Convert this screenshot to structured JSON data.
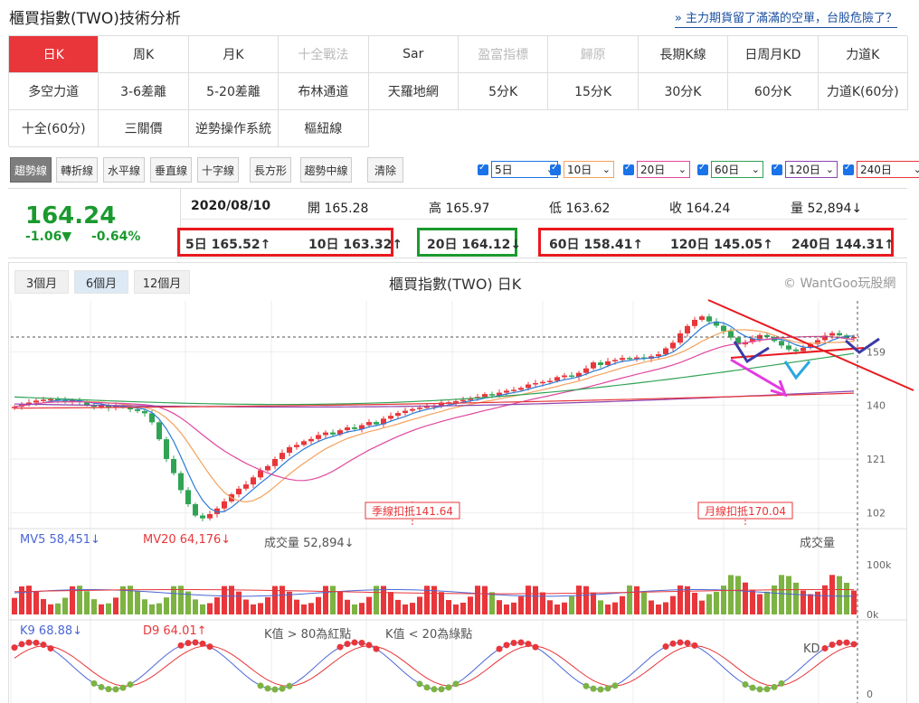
{
  "header": {
    "title": "櫃買指數(TWO)技術分析",
    "link": "» 主力期貨留了滿滿的空單，台股危險了？"
  },
  "grid": [
    {
      "label": "日K",
      "state": "active"
    },
    {
      "label": "周K"
    },
    {
      "label": "月K"
    },
    {
      "label": "十全戰法",
      "state": "disabled"
    },
    {
      "label": "Sar"
    },
    {
      "label": "盈富指標",
      "state": "disabled"
    },
    {
      "label": "歸原",
      "state": "disabled"
    },
    {
      "label": "長期K線"
    },
    {
      "label": "日周月KD"
    },
    {
      "label": "力道K"
    },
    {
      "label": "多空力道"
    },
    {
      "label": "3-6差離"
    },
    {
      "label": "5-20差離"
    },
    {
      "label": "布林通道"
    },
    {
      "label": "天羅地網"
    },
    {
      "label": "5分K"
    },
    {
      "label": "15分K"
    },
    {
      "label": "30分K"
    },
    {
      "label": "60分K"
    },
    {
      "label": "力道K(60分)"
    },
    {
      "label": "十全(60分)"
    },
    {
      "label": "三關價"
    },
    {
      "label": "逆勢操作系統"
    },
    {
      "label": "樞紐線"
    }
  ],
  "tools": [
    "趨勢線",
    "轉折線",
    "水平線",
    "垂直線",
    "十字線",
    "長方形",
    "趨勢中線",
    "清除"
  ],
  "ma_selectors": [
    {
      "label": "5日",
      "color": "#1a73e8"
    },
    {
      "label": "10日",
      "color": "#f5a25d"
    },
    {
      "label": "20日",
      "color": "#e0479e"
    },
    {
      "label": "60日",
      "color": "#31a354"
    },
    {
      "label": "120日",
      "color": "#8e44ad"
    },
    {
      "label": "240日",
      "color": "#e8363a"
    }
  ],
  "quote": {
    "price": "164.24",
    "change": "-1.06▼",
    "change_pct": "-0.64%",
    "date": "2020/08/10",
    "open": "開 165.28",
    "high": "高 165.97",
    "low": "低 163.62",
    "close": "收 164.24",
    "volume": "量 52,894↓"
  },
  "ma_values": [
    {
      "label": "5日 165.52↑",
      "color": "#2a7bd6"
    },
    {
      "label": "10日 163.32↑",
      "color": "#f0a060"
    },
    {
      "label": "20日 164.12↓",
      "color": "#e0479e"
    },
    {
      "label": "60日 158.41↑",
      "color": "#31a354"
    },
    {
      "label": "120日 145.05↑",
      "color": "#8e44ad"
    },
    {
      "label": "240日 144.31↑",
      "color": "#e8363a"
    }
  ],
  "ranges": [
    "3個月",
    "6個月",
    "12個月"
  ],
  "chart_title": "櫃買指數(TWO) 日K",
  "watermark": "© WantGoo玩股網",
  "annotations": {
    "quarter_line": "季線扣抵141.64",
    "month_line": "月線扣抵170.04"
  },
  "volume_panel": {
    "mv5": "MV5 58,451↓",
    "mv20": "MV20 64,176↓",
    "volume": "成交量 52,894↓",
    "label": "成交量"
  },
  "kd_panel": {
    "k": "K9 68.88↓",
    "d": "D9 64.01↑",
    "rule_red": "K值 > 80為紅點",
    "rule_green": "K值 < 20為綠點",
    "label": "KD"
  },
  "chart_data": [
    {
      "type": "candlestick",
      "title": "櫃買指數(TWO) 日K",
      "yticks": [
        102,
        121,
        140,
        159
      ],
      "ylim": [
        97,
        177
      ],
      "up_color": "#e8363a",
      "down_color": "#31a354",
      "closes": [
        139.5,
        140.3,
        141,
        141.7,
        142,
        142.2,
        141.8,
        141.4,
        141.7,
        141.1,
        140.2,
        139.5,
        139.9,
        139.1,
        140,
        139.4,
        138.6,
        138,
        137.2,
        134,
        128,
        121,
        116,
        110,
        105,
        101,
        100,
        101.5,
        103.5,
        106,
        108.5,
        110.5,
        112,
        114.5,
        117,
        118.5,
        121,
        123.2,
        125.2,
        126,
        127.3,
        128.1,
        129.5,
        130.4,
        129.7,
        131.2,
        132.2,
        131.6,
        133,
        134.1,
        133.3,
        135.3,
        136.3,
        137.3,
        138.1,
        138.7,
        139.2,
        139.6,
        139.9,
        141,
        141.1,
        141.5,
        141.9,
        142.5,
        143,
        144,
        143.5,
        144.5,
        145.2,
        145.5,
        146.2,
        147.4,
        147.9,
        148.3,
        148.7,
        150,
        150.6,
        150.1,
        151.5,
        153.1,
        155.2,
        154.3,
        155.6,
        156.1,
        156.8,
        156.5,
        157,
        156.5,
        157.4,
        158.1,
        160.2,
        162.2,
        165.5,
        168.1,
        170.3,
        171.5,
        169.7,
        168.2,
        166.3,
        164,
        161.6,
        162.4,
        163.6,
        164.9,
        164.2,
        162.8,
        161.2,
        159.8,
        159.2,
        160.4,
        161.7,
        163.1,
        164.7,
        165.6,
        164.8,
        163.8,
        164.2
      ],
      "series": [
        {
          "name": "5日",
          "last": 165.52
        },
        {
          "name": "10日",
          "last": 163.32
        },
        {
          "name": "20日",
          "last": 164.12
        },
        {
          "name": "60日",
          "last": 158.41
        },
        {
          "name": "120日",
          "last": 145.05
        },
        {
          "name": "240日",
          "last": 144.31
        }
      ]
    },
    {
      "type": "bar",
      "title": "成交量",
      "yticks": [
        "100k",
        "0k"
      ],
      "ylim": [
        0,
        120
      ]
    },
    {
      "type": "line",
      "title": "KD",
      "yticks": [
        0
      ],
      "ylim": [
        0,
        100
      ],
      "series": [
        {
          "name": "K9",
          "last": 68.88
        },
        {
          "name": "D9",
          "last": 64.01
        }
      ]
    }
  ]
}
